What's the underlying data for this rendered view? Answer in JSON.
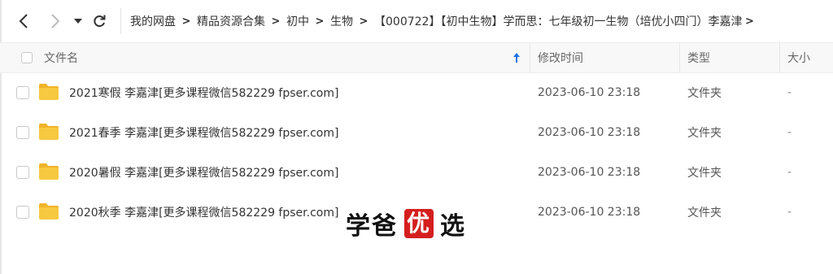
{
  "nav": {
    "back_icon": "chevron-left-icon",
    "forward_icon": "chevron-right-icon",
    "dropdown_icon": "caret-down-icon",
    "refresh_icon": "refresh-icon"
  },
  "breadcrumb": [
    "我的网盘",
    "精品资源合集",
    "初中",
    "生物",
    "【000722】【初中生物】学而思：七年级初一生物（培优小四门）李嘉津"
  ],
  "breadcrumb_separator": ">",
  "columns": {
    "name": "文件名",
    "modified": "修改时间",
    "type": "类型",
    "size": "大小"
  },
  "sort": {
    "column": "name",
    "direction": "ascending"
  },
  "files": [
    {
      "name": "2021寒假 李嘉津[更多课程微信582229 fpser.com]",
      "modified": "2023-06-10 23:18",
      "type": "文件夹",
      "size": "-"
    },
    {
      "name": "2021春季 李嘉津[更多课程微信582229 fpser.com]",
      "modified": "2023-06-10 23:18",
      "type": "文件夹",
      "size": "-"
    },
    {
      "name": "2020暑假 李嘉津[更多课程微信582229 fpser.com]",
      "modified": "2023-06-10 23:18",
      "type": "文件夹",
      "size": "-"
    },
    {
      "name": "2020秋季 李嘉津[更多课程微信582229 fpser.com]",
      "modified": "2023-06-10 23:18",
      "type": "文件夹",
      "size": "-"
    }
  ],
  "watermark": {
    "char1": "学",
    "char2": "爸",
    "char3": "优",
    "char4": "选"
  },
  "colors": {
    "folder": "#f7c940",
    "folder_back": "#f0b429",
    "sort_arrow": "#1a73e8",
    "watermark_box": "#d51e1e"
  }
}
